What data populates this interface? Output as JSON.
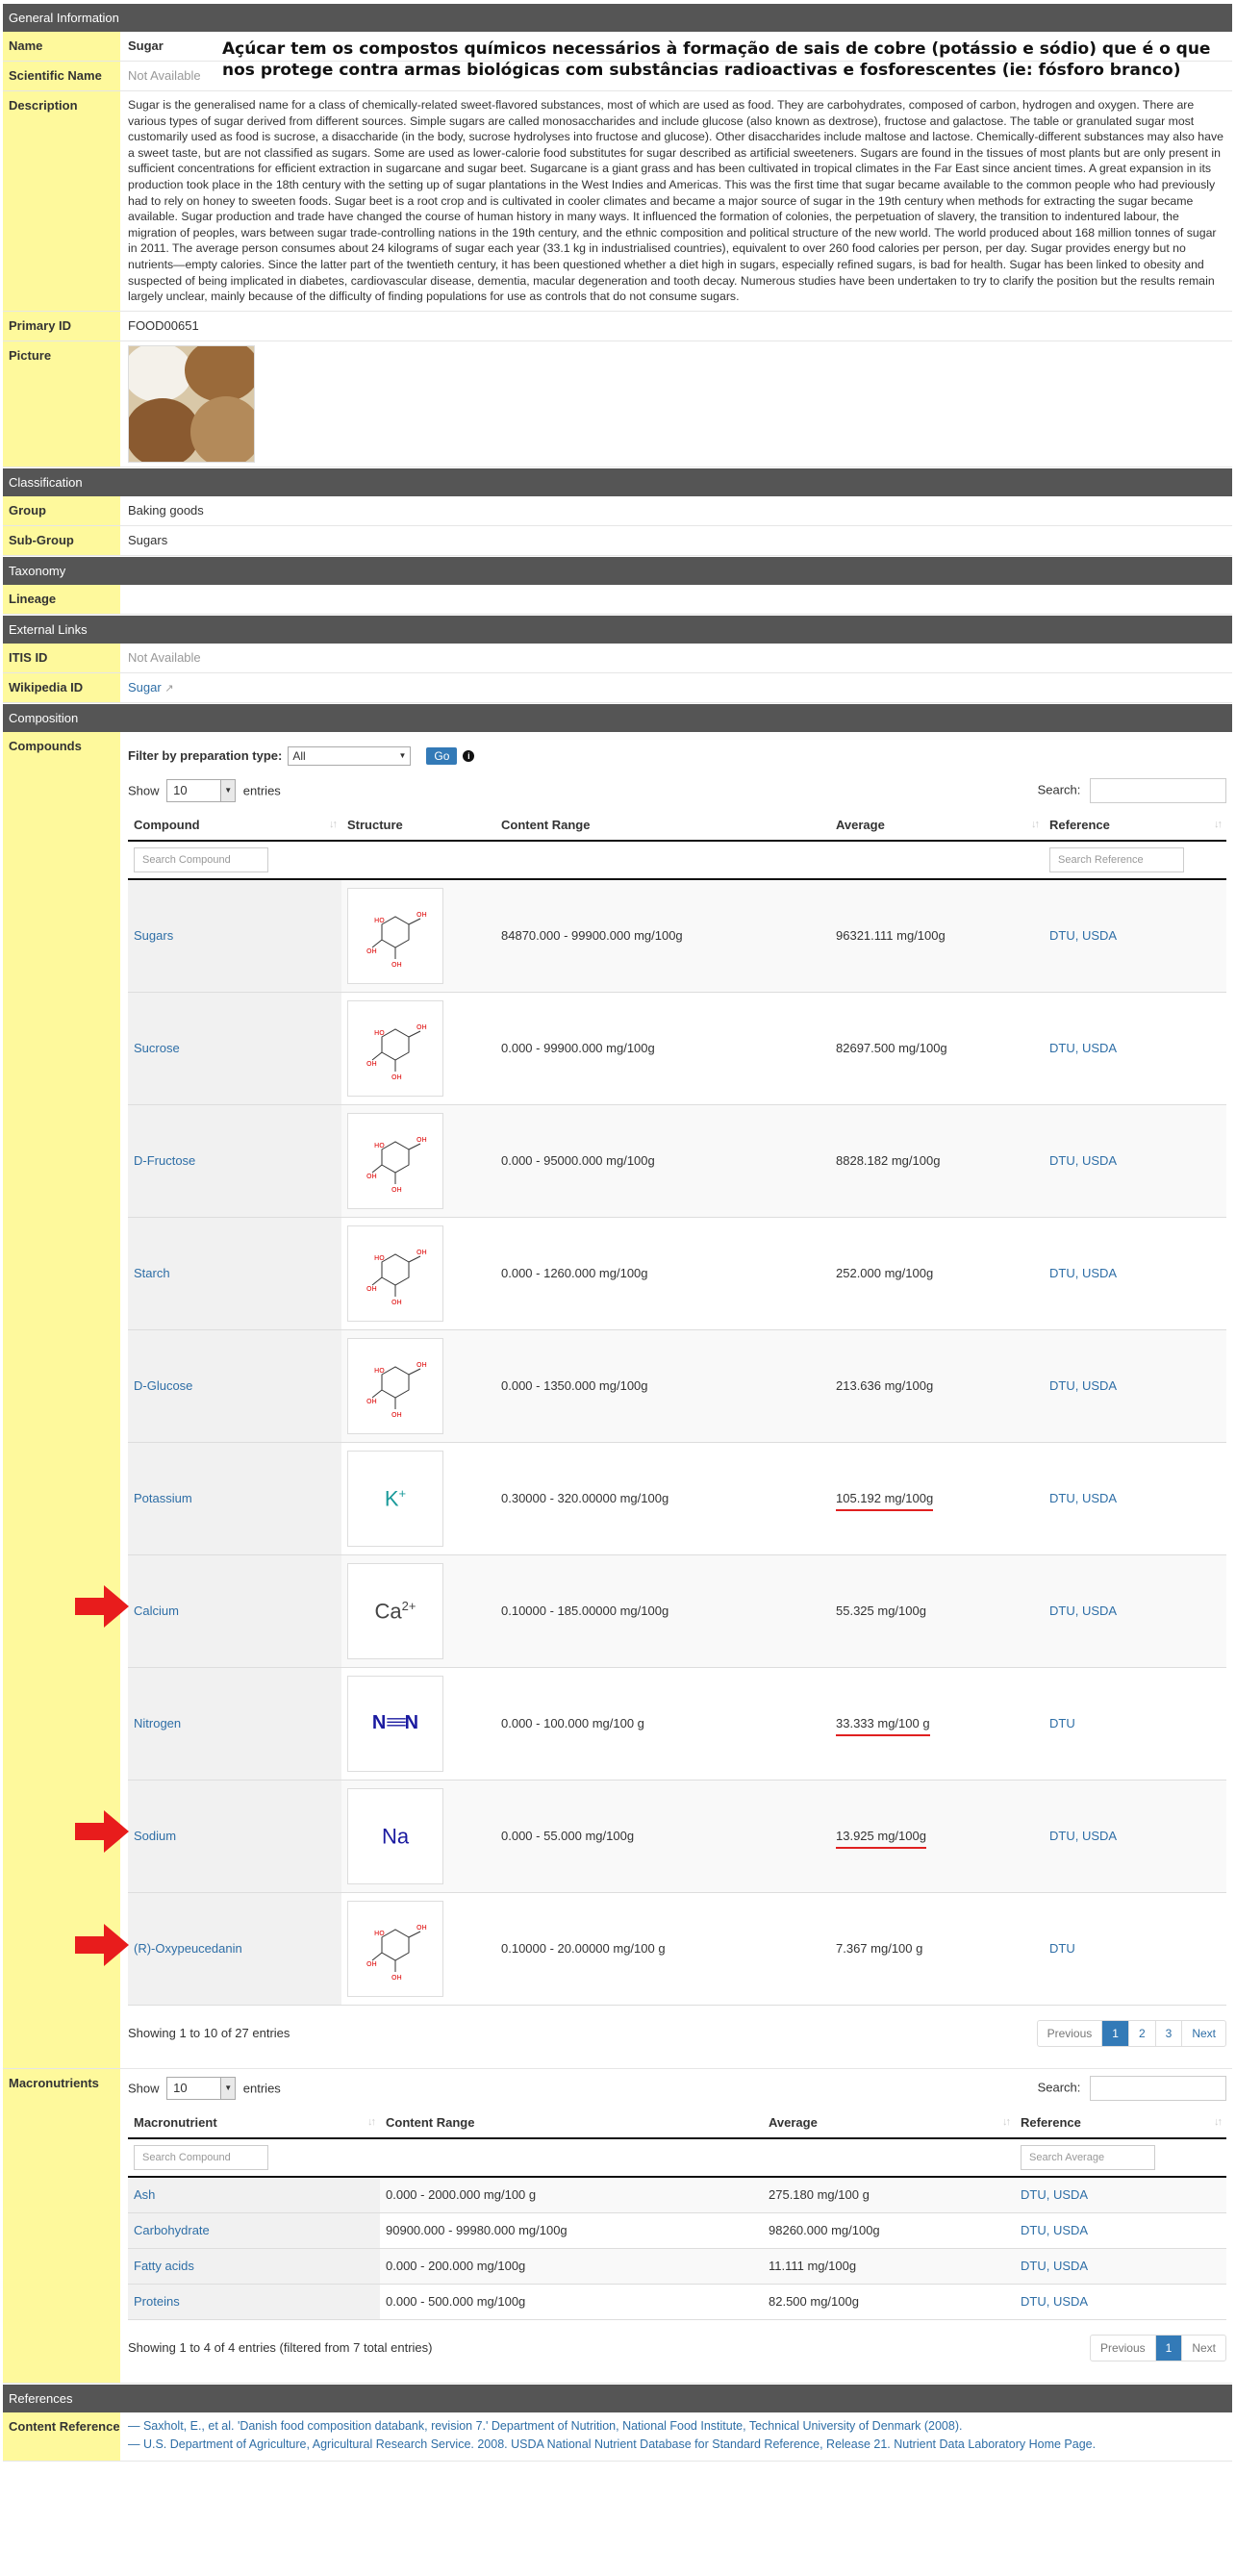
{
  "annotation": "Açúcar tem os compostos químicos necessários à formação de sais de cobre (potássio e sódio) que é o que nos protege contra armas biológicas com substâncias radioactivas e fosforescentes (ie: fósforo branco)",
  "general": {
    "header": "General Information",
    "name_label": "Name",
    "name_value": "Sugar",
    "sci_label": "Scientific Name",
    "sci_value": "Not Available",
    "desc_label": "Description",
    "desc_value": "Sugar is the generalised name for a class of chemically-related sweet-flavored substances, most of which are used as food. They are carbohydrates, composed of carbon, hydrogen and oxygen. There are various types of sugar derived from different sources. Simple sugars are called monosaccharides and include glucose (also known as dextrose), fructose and galactose. The table or granulated sugar most customarily used as food is sucrose, a disaccharide (in the body, sucrose hydrolyses into fructose and glucose). Other disaccharides include maltose and lactose. Chemically-different substances may also have a sweet taste, but are not classified as sugars. Some are used as lower-calorie food substitutes for sugar described as artificial sweeteners. Sugars are found in the tissues of most plants but are only present in sufficient concentrations for efficient extraction in sugarcane and sugar beet. Sugarcane is a giant grass and has been cultivated in tropical climates in the Far East since ancient times. A great expansion in its production took place in the 18th century with the setting up of sugar plantations in the West Indies and Americas. This was the first time that sugar became available to the common people who had previously had to rely on honey to sweeten foods. Sugar beet is a root crop and is cultivated in cooler climates and became a major source of sugar in the 19th century when methods for extracting the sugar became available. Sugar production and trade have changed the course of human history in many ways. It influenced the formation of colonies, the perpetuation of slavery, the transition to indentured labour, the migration of peoples, wars between sugar trade-controlling nations in the 19th century, and the ethnic composition and political structure of the new world. The world produced about 168 million tonnes of sugar in 2011. The average person consumes about 24 kilograms of sugar each year (33.1 kg in industrialised countries), equivalent to over 260 food calories per person, per day. Sugar provides energy but no nutrients—empty calories. Since the latter part of the twentieth century, it has been questioned whether a diet high in sugars, especially refined sugars, is bad for health. Sugar has been linked to obesity and suspected of being implicated in diabetes, cardiovascular disease, dementia, macular degeneration and tooth decay. Numerous studies have been undertaken to try to clarify the position but the results remain largely unclear, mainly because of the difficulty of finding populations for use as controls that do not consume sugars.",
    "pid_label": "Primary ID",
    "pid_value": "FOOD00651",
    "pic_label": "Picture"
  },
  "classification": {
    "header": "Classification",
    "group_label": "Group",
    "group_value": "Baking goods",
    "subgroup_label": "Sub-Group",
    "subgroup_value": "Sugars"
  },
  "taxonomy": {
    "header": "Taxonomy",
    "lineage_label": "Lineage"
  },
  "links": {
    "header": "External Links",
    "itis_label": "ITIS ID",
    "itis_value": "Not Available",
    "wiki_label": "Wikipedia ID",
    "wiki_value": "Sugar"
  },
  "composition": {
    "header": "Composition",
    "compounds_label": "Compounds",
    "filter_label": "Filter by preparation type:",
    "filter_value": "All",
    "go_label": "Go",
    "show_label": "Show",
    "show_value": "10",
    "entries_label": "entries",
    "search_label": "Search:",
    "columns": [
      "Compound",
      "Structure",
      "Content Range",
      "Average",
      "Reference"
    ],
    "search_compound_ph": "Search Compound",
    "search_reference_ph": "Search Reference",
    "rows": [
      {
        "name": "Sugars",
        "range": "84870.000 - 99900.000 mg/100g",
        "avg": "96321.111 mg/100g",
        "ref": "DTU, USDA"
      },
      {
        "name": "Sucrose",
        "range": "0.000 - 99900.000 mg/100g",
        "avg": "82697.500 mg/100g",
        "ref": "DTU, USDA"
      },
      {
        "name": "D-Fructose",
        "range": "0.000 - 95000.000 mg/100g",
        "avg": "8828.182 mg/100g",
        "ref": "DTU, USDA"
      },
      {
        "name": "Starch",
        "range": "0.000 - 1260.000 mg/100g",
        "avg": "252.000 mg/100g",
        "ref": "DTU, USDA"
      },
      {
        "name": "D-Glucose",
        "range": "0.000 - 1350.000 mg/100g",
        "avg": "213.636 mg/100g",
        "ref": "DTU, USDA"
      },
      {
        "name": "Potassium",
        "range": "0.30000 - 320.00000 mg/100g",
        "avg": "105.192 mg/100g",
        "ref": "DTU, USDA",
        "formula": "K",
        "charge": "+"
      },
      {
        "name": "Calcium",
        "range": "0.10000 - 185.00000 mg/100g",
        "avg": "55.325 mg/100g",
        "ref": "DTU, USDA",
        "formula": "Ca",
        "charge": "2+"
      },
      {
        "name": "Nitrogen",
        "range": "0.000 - 100.000 mg/100 g",
        "avg": "33.333 mg/100 g",
        "ref": "DTU",
        "formula": "N≡N"
      },
      {
        "name": "Sodium",
        "range": "0.000 - 55.000 mg/100g",
        "avg": "13.925 mg/100g",
        "ref": "DTU, USDA",
        "formula": "Na"
      },
      {
        "name": "(R)-Oxypeucedanin",
        "range": "0.10000 - 20.00000 mg/100 g",
        "avg": "7.367 mg/100 g",
        "ref": "DTU"
      }
    ],
    "info": "Showing 1 to 10 of 27 entries",
    "pager": [
      "Previous",
      "1",
      "2",
      "3",
      "Next"
    ]
  },
  "macros": {
    "label": "Macronutrients",
    "columns": [
      "Macronutrient",
      "Content Range",
      "Average",
      "Reference"
    ],
    "search_compound_ph": "Search Compound",
    "search_average_ph": "Search Average",
    "rows": [
      {
        "name": "Ash",
        "range": "0.000 - 2000.000 mg/100 g",
        "avg": "275.180 mg/100 g",
        "ref": "DTU, USDA"
      },
      {
        "name": "Carbohydrate",
        "range": "90900.000 - 99980.000 mg/100g",
        "avg": "98260.000 mg/100g",
        "ref": "DTU, USDA"
      },
      {
        "name": "Fatty acids",
        "range": "0.000 - 200.000 mg/100g",
        "avg": "11.111 mg/100g",
        "ref": "DTU, USDA"
      },
      {
        "name": "Proteins",
        "range": "0.000 - 500.000 mg/100g",
        "avg": "82.500 mg/100g",
        "ref": "DTU, USDA"
      }
    ],
    "info": "Showing 1 to 4 of 4 entries (filtered from 7 total entries)",
    "pager": [
      "Previous",
      "1",
      "Next"
    ]
  },
  "references": {
    "header": "References",
    "label": "Content Reference",
    "items": [
      "— Saxholt, E., et al. 'Danish food composition databank, revision 7.' Department of Nutrition, National Food Institute, Technical University of Denmark (2008).",
      "— U.S. Department of Agriculture, Agricultural Research Service. 2008. USDA National Nutrient Database for Standard Reference, Release 21. Nutrient Data Laboratory Home Page."
    ]
  },
  "colors": {
    "label_bg": "#fef99c",
    "header_bg": "#555555",
    "link": "#2e6ea6",
    "highlight": "#e02020"
  }
}
